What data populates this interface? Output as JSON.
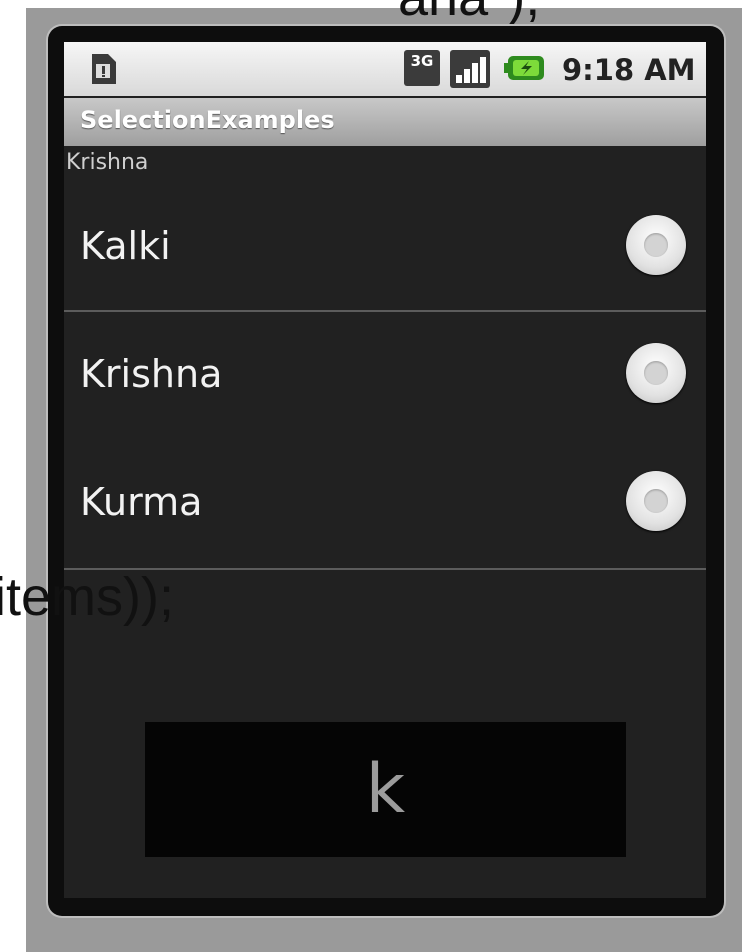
{
  "background_code": {
    "top": "ana\");",
    "middle": "items));"
  },
  "status_bar": {
    "network_label": "3G",
    "time": "9:18 AM"
  },
  "title_bar": {
    "title": "SelectionExamples"
  },
  "selection_display": "Krishna",
  "list": {
    "items": [
      {
        "label": "Kalki",
        "checked": false
      },
      {
        "label": "Krishna",
        "checked": false
      },
      {
        "label": "Kurma",
        "checked": false
      }
    ]
  },
  "overlay": {
    "text": "k"
  },
  "colors": {
    "screen_bg": "#212121",
    "title_bar": "#b4b4b4",
    "status_bar": "#e6e6e6"
  }
}
